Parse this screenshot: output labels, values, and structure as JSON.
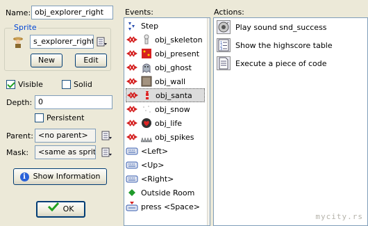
{
  "left": {
    "name_label": "Name:",
    "name_value": "obj_explorer_right",
    "sprite_group_title": "Sprite",
    "sprite_value": "s_explorer_right",
    "new_button": "New",
    "edit_button": "Edit",
    "visible_label": "Visible",
    "solid_label": "Solid",
    "visible_checked": true,
    "solid_checked": false,
    "depth_label": "Depth:",
    "depth_value": "0",
    "persistent_label": "Persistent",
    "persistent_checked": false,
    "parent_label": "Parent:",
    "parent_value": "<no parent>",
    "mask_label": "Mask:",
    "mask_value": "<same as sprite>",
    "show_info_button": "Show Information",
    "ok_button": "OK"
  },
  "events": {
    "title": "Events:",
    "items": [
      {
        "label": "Step",
        "icon": "step-icon"
      },
      {
        "label": "obj_skeleton",
        "icon": "collision-icon"
      },
      {
        "label": "obj_present",
        "icon": "collision-icon"
      },
      {
        "label": "obj_ghost",
        "icon": "collision-icon"
      },
      {
        "label": "obj_wall",
        "icon": "collision-icon"
      },
      {
        "label": "obj_santa",
        "icon": "collision-icon",
        "selected": true
      },
      {
        "label": "obj_snow",
        "icon": "collision-icon"
      },
      {
        "label": "obj_life",
        "icon": "collision-icon"
      },
      {
        "label": "obj_spikes",
        "icon": "collision-icon"
      },
      {
        "label": "<Left>",
        "icon": "keyboard-icon"
      },
      {
        "label": "<Up>",
        "icon": "keyboard-icon"
      },
      {
        "label": "<Right>",
        "icon": "keyboard-icon"
      },
      {
        "label": "Outside Room",
        "icon": "outside-room-icon"
      },
      {
        "label": "press <Space>",
        "icon": "key-press-icon"
      }
    ]
  },
  "actions": {
    "title": "Actions:",
    "items": [
      {
        "label": "Play sound snd_success",
        "icon": "sound-icon"
      },
      {
        "label": "Show the highscore table",
        "icon": "highscore-icon"
      },
      {
        "label": "Execute a piece of code",
        "icon": "code-icon"
      }
    ]
  },
  "watermark": "mycity.rs",
  "colors": {
    "accent": "#0046d5",
    "selected_bg": "#dcdcdc",
    "ok_check": "#21a121"
  }
}
